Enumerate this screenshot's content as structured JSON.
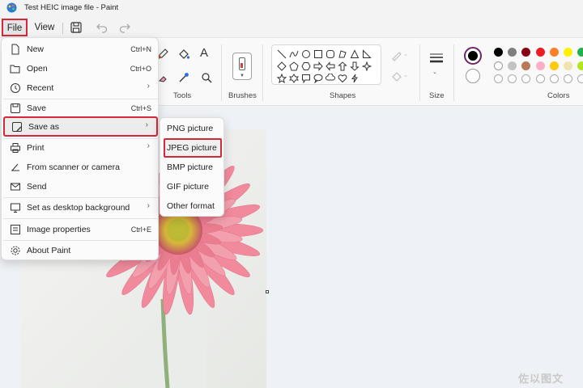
{
  "window": {
    "title": "Test HEIC image file - Paint"
  },
  "menubar": {
    "file_label": "File",
    "view_label": "View"
  },
  "ribbon": {
    "groups": {
      "tools": "Tools",
      "brushes": "Brushes",
      "shapes": "Shapes",
      "size": "Size",
      "colors": "Colors"
    },
    "text_tool_glyph": "A",
    "colors_row1": [
      "#000000",
      "#7f7f7f",
      "#880015",
      "#ed1c24",
      "#ff7f27",
      "#fff200",
      "#22b14c"
    ],
    "colors_row2": [
      "#ffffff",
      "#c3c3c3",
      "#b97a57",
      "#ffaec9",
      "#ffc90e",
      "#efe4b0",
      "#b5e61d"
    ],
    "colors_row3": [
      "empty",
      "empty",
      "empty",
      "empty",
      "empty",
      "empty",
      "empty"
    ]
  },
  "file_menu": {
    "items": [
      {
        "label": "New",
        "shortcut": "Ctrl+N",
        "icon": "new-file-icon"
      },
      {
        "label": "Open",
        "shortcut": "Ctrl+O",
        "icon": "open-file-icon"
      },
      {
        "label": "Recent",
        "icon": "clock-icon",
        "arrow": "›"
      },
      {
        "label": "Save",
        "shortcut": "Ctrl+S",
        "icon": "save-icon"
      },
      {
        "label": "Save as",
        "icon": "save-as-icon",
        "arrow": "›"
      },
      {
        "label": "Print",
        "icon": "print-icon",
        "arrow": "›"
      },
      {
        "label": "From scanner or camera",
        "icon": "scanner-icon"
      },
      {
        "label": "Send",
        "icon": "send-icon"
      },
      {
        "label": "Set as desktop background",
        "icon": "desktop-icon",
        "arrow": "›"
      },
      {
        "label": "Image properties",
        "shortcut": "Ctrl+E",
        "icon": "image-properties-icon"
      },
      {
        "label": "About Paint",
        "icon": "gear-icon"
      }
    ]
  },
  "save_as_menu": {
    "items": [
      "PNG picture",
      "JPEG picture",
      "BMP picture",
      "GIF picture",
      "Other format"
    ]
  },
  "watermark": "佐以图文"
}
